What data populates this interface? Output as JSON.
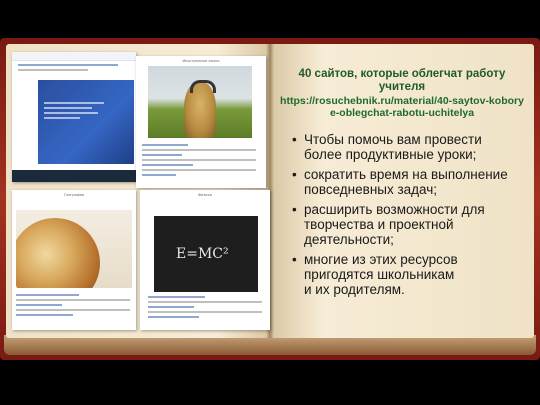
{
  "header": {
    "title": "40 сайтов, которые облегчат работу учителя",
    "link": "https://rosuchebnik.ru/material/40-saytov-koborye-oblegchat-rabotu-uchitelya"
  },
  "bullets": [
    "Чтобы помочь вам провести\nболее продуктивные уроки;",
    "сократить время на выполнение\nповседневных задач;",
    "расширить возможности для\nтворчества и проектной\nдеятельности;",
    "многие из этих ресурсов\nпригодятся школьникам\nи их родителям."
  ],
  "cards": {
    "photo_caption": "Иностранные языки",
    "globe_caption": "География",
    "board_caption": "Физика",
    "board_formula": "E=MC²"
  },
  "colors": {
    "cover": "#a33220",
    "page": "#f7ecd6",
    "title_green": "#1f5a2a",
    "hero_blue": "#2a4fa0"
  }
}
